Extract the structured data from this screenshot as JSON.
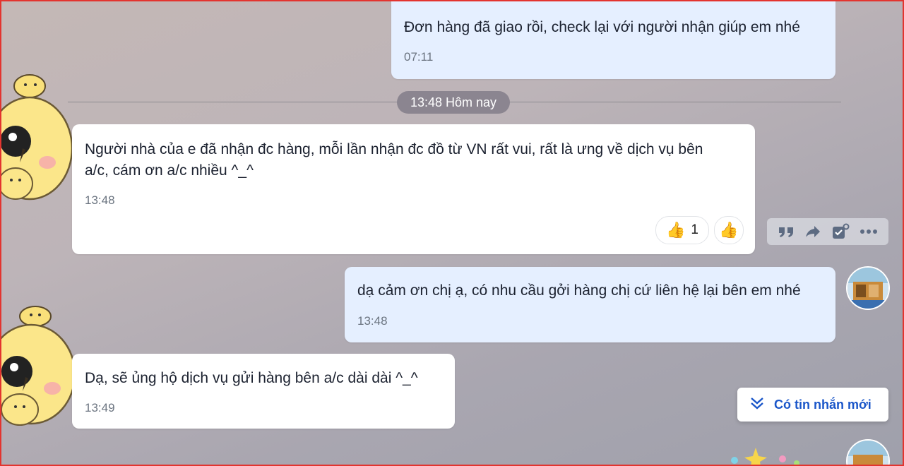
{
  "chat": {
    "messages": [
      {
        "direction": "sent",
        "text": "Đơn hàng đã giao rồi, check lại với người nhận giúp em nhé",
        "time": "07:11"
      },
      {
        "direction": "received",
        "text_line1": "Người nhà của e đã nhận đc hàng, mỗi lần nhận đc đồ từ VN rất vui, rất là ưng về dịch vụ bên",
        "text_line2": "a/c, cám ơn a/c nhiều ^_^",
        "time": "13:48"
      },
      {
        "direction": "sent",
        "text": "dạ cảm ơn chị ạ, có nhu cầu gởi hàng chị cứ liên hệ lại bên em nhé",
        "time": "13:48"
      },
      {
        "direction": "received",
        "text": "Dạ, sẽ ủng hộ dịch vụ gửi hàng bên a/c dài dài ^_^",
        "time": "13:49"
      }
    ],
    "divider_label": "13:48 Hôm nay",
    "reactions": {
      "like_count": "1",
      "like_icon": "thumbs-up-icon",
      "add_icon": "thumbs-up-icon"
    },
    "message_actions": [
      "quote-icon",
      "forward-icon",
      "mark-task-icon",
      "more-icon"
    ],
    "new_message_button": {
      "label": "Có tin nhắn mới",
      "icon": "double-chevron-down-icon"
    }
  },
  "colors": {
    "sent_bubble": "#e5efff",
    "received_bubble": "#ffffff",
    "accent": "#1a56c9",
    "divider_pill": "#8b8590",
    "frame": "#e3342f"
  }
}
